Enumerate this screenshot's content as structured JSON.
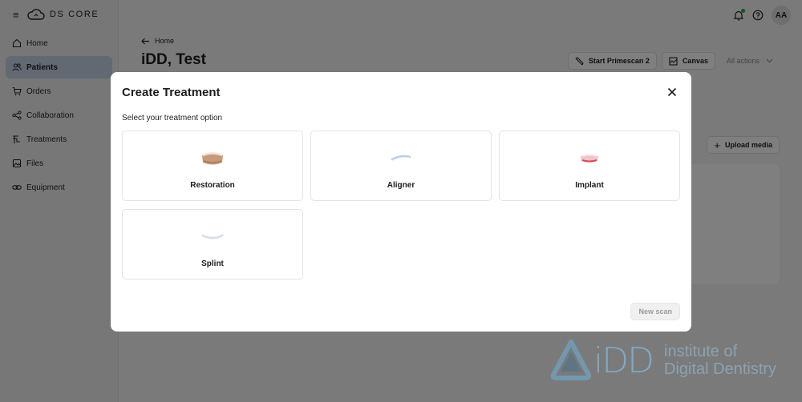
{
  "app": {
    "logo_text": "DS CORE",
    "user_initials": "AA"
  },
  "sidebar": {
    "items": [
      {
        "label": "Home",
        "icon": "home-icon"
      },
      {
        "label": "Patients",
        "icon": "patients-icon",
        "active": true
      },
      {
        "label": "Orders",
        "icon": "cart-icon"
      },
      {
        "label": "Collaboration",
        "icon": "share-icon"
      },
      {
        "label": "Treatments",
        "icon": "treatments-icon"
      },
      {
        "label": "Files",
        "icon": "files-icon"
      },
      {
        "label": "Equipment",
        "icon": "link-icon"
      }
    ]
  },
  "page": {
    "back_label": "Home",
    "title": "iDD, Test",
    "actions": {
      "primescan": "Start Primescan 2",
      "canvas": "Canvas",
      "all_actions": "All actions"
    },
    "upload_media": "Upload media"
  },
  "modal": {
    "title": "Create Treatment",
    "subtitle": "Select your treatment option",
    "options": [
      {
        "label": "Restoration",
        "icon": "restoration-icon"
      },
      {
        "label": "Aligner",
        "icon": "aligner-icon"
      },
      {
        "label": "Implant",
        "icon": "implant-icon"
      },
      {
        "label": "Splint",
        "icon": "splint-icon"
      }
    ],
    "new_scan": "New scan"
  },
  "watermark": {
    "brand": "iDD",
    "line1": "institute of",
    "line2": "Digital Dentistry"
  },
  "colors": {
    "active_nav": "#c4d3e6",
    "notification_dot": "#2aa845",
    "watermark_blue": "#7fb3d4"
  }
}
